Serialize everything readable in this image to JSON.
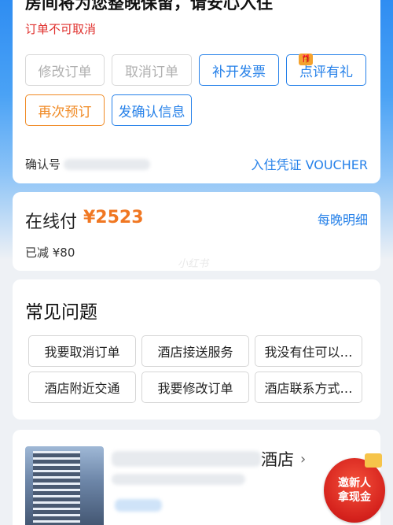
{
  "order": {
    "headline": "房间将为您整晚保留，请安心入住",
    "cancel_notice": "订单不可取消",
    "buttons": {
      "modify": "修改订单",
      "cancel": "取消订单",
      "invoice": "补开发票",
      "review": "点评有礼",
      "rebook": "再次预订",
      "send_confirm": "发确认信息"
    },
    "confirm_label": "确认号",
    "voucher_link": "入住凭证 VOUCHER"
  },
  "payment": {
    "label": "在线付",
    "amount": "¥2523",
    "nightly_link": "每晚明细",
    "discount": "已减 ¥80",
    "watermark": "小红书"
  },
  "faq": {
    "title": "常见问题",
    "items": [
      "我要取消订单",
      "酒店接送服务",
      "我没有住可以…",
      "酒店附近交通",
      "我要修改订单",
      "酒店联系方式…"
    ]
  },
  "hotel": {
    "name_suffix": "酒店"
  },
  "promo": {
    "line1": "邀新人",
    "line2": "拿现金"
  },
  "colors": {
    "accent_blue": "#2681e9",
    "price_orange": "#f07722",
    "warn_red": "#e0312e"
  }
}
